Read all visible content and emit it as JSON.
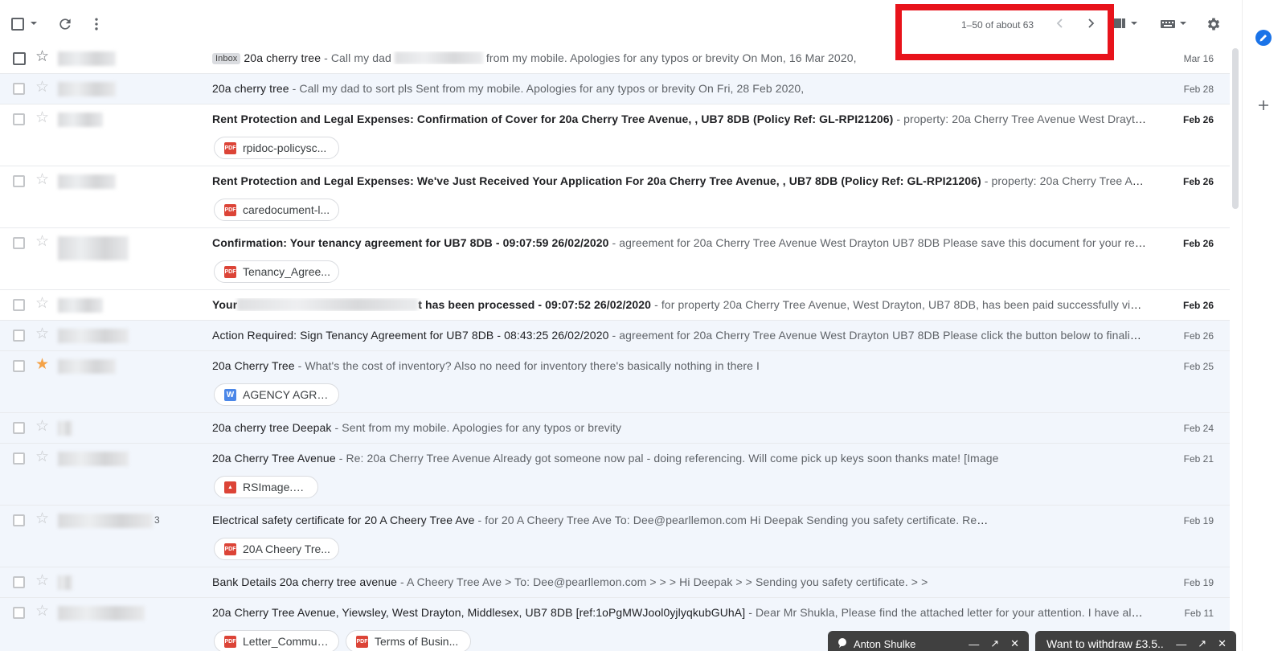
{
  "toolbar": {
    "pager_text": "1–50 of about 63"
  },
  "emails": [
    {
      "badge": "Inbox",
      "subject": "20a cherry tree",
      "snippet": " - Call my dad ",
      "snippet_after": " from my mobile. Apologies for any typos or brevity On Mon, 16 Mar 2020,",
      "date": "Mar 16",
      "unread": false,
      "starred": false,
      "attachments": []
    },
    {
      "subject": "20a cherry tree",
      "snippet": " - Call my dad to sort pls Sent from my mobile. Apologies for any typos or brevity On Fri, 28 Feb 2020,",
      "date": "Feb 28",
      "unread": false,
      "starred": false,
      "attachments": []
    },
    {
      "subject": "Rent Protection and Legal Expenses: Confirmation of Cover for 20a Cherry Tree Avenue, , UB7 8DB (Policy Ref: GL-RPI21206)",
      "snippet": " - property: 20a Cherry Tree Avenue West Drayton UB7 8DB ...",
      "date": "Feb 26",
      "unread": true,
      "starred": false,
      "attachments": [
        {
          "type": "pdf",
          "name": "rpidoc-policysc..."
        }
      ]
    },
    {
      "subject": "Rent Protection and Legal Expenses: We've Just Received Your Application For 20a Cherry Tree Avenue, , UB7 8DB (Policy Ref: GL-RPI21206)",
      "snippet": " - property: 20a Cherry Tree Avenue West Dr...",
      "date": "Feb 26",
      "unread": true,
      "starred": false,
      "attachments": [
        {
          "type": "pdf",
          "name": "caredocument-l..."
        }
      ]
    },
    {
      "subject": "Confirmation: Your tenancy agreement for UB7 8DB - 09:07:59 26/02/2020",
      "snippet": " - agreement for 20a Cherry Tree Avenue West Drayton UB7 8DB Please save this document for your records. Re...",
      "date": "Feb 26",
      "unread": true,
      "starred": false,
      "attachments": [
        {
          "type": "pdf",
          "name": "Tenancy_Agree..."
        }
      ]
    },
    {
      "subject_prefix": "Your",
      "subject": "t has been processed - 09:07:52 26/02/2020",
      "snippet": " - for property 20a Cherry Tree Avenue, West Drayton, UB7 8DB, has been paid successfully via the goo...",
      "date": "Feb 26",
      "unread": true,
      "starred": false,
      "attachments": []
    },
    {
      "subject": "Action Required: Sign Tenancy Agreement for UB7 8DB - 08:43:25 26/02/2020",
      "snippet": " - agreement for 20a Cherry Tree Avenue West Drayton UB7 8DB Please click the button below to finalise the a...",
      "date": "Feb 26",
      "unread": false,
      "starred": false,
      "attachments": []
    },
    {
      "subject": "20a Cherry Tree",
      "snippet": " - What's the cost of inventory? Also no need for inventory there's basically nothing in there I",
      "date": "Feb 25",
      "unread": false,
      "starred": true,
      "attachments": [
        {
          "type": "word",
          "name": "AGENCY AGRE..."
        }
      ]
    },
    {
      "subject": "20a cherry tree Deepak",
      "snippet": " - Sent from my mobile. Apologies for any typos or brevity",
      "date": "Feb 24",
      "unread": false,
      "starred": false,
      "attachments": []
    },
    {
      "subject": "20a Cherry Tree Avenue",
      "snippet": " - Re: 20a Cherry Tree Avenue Already got someone now pal - doing referencing. Will come pick up keys soon thanks mate! [Image",
      "date": "Feb 21",
      "unread": false,
      "starred": false,
      "attachments": [
        {
          "type": "img",
          "name": "RSImage.png"
        }
      ]
    },
    {
      "sender_count": "3",
      "subject": "Electrical safety certificate for 20 A Cheery Tree Ave",
      "snippet": " - for 20 A Cheery Tree Ave To: Dee@pearllemon.com Hi Deepak Sending you safety certificate. Re",
      "date": "Feb 19",
      "unread": false,
      "starred": false,
      "attachments": [
        {
          "type": "pdf",
          "name": "20A Cheery Tre..."
        }
      ]
    },
    {
      "subject": "Bank Details 20a cherry tree avenue",
      "snippet": " - A Cheery Tree Ave > To: Dee@pearllemon.com > > > Hi Deepak > > Sending you safety certificate. > >",
      "date": "Feb 19",
      "unread": false,
      "starred": false,
      "attachments": []
    },
    {
      "subject": "20a Cherry Tree Avenue, Yiewsley, West Drayton, Middlesex, UB7 8DB [ref:1oPgMWJool0yjlyqkubGUhA]",
      "snippet": " - Dear Mr Shukla, Please find the attached letter for your attention. I have also attac...",
      "date": "Feb 11",
      "unread": false,
      "starred": false,
      "attachments": [
        {
          "type": "pdf",
          "name": "Letter_Commun..."
        },
        {
          "type": "pdf",
          "name": "Terms of Busin..."
        }
      ]
    }
  ],
  "chats": [
    {
      "name": "Anton Shulke"
    },
    {
      "name": "Want to withdraw £3.5..."
    }
  ],
  "colors": {
    "highlight": "#e8131b",
    "star_on": "#f4a247",
    "chat_bar": "#404040"
  },
  "icons": [
    "select-all-checkbox",
    "chevron-down-icon",
    "refresh-icon",
    "more-vert-icon",
    "chevron-left-icon",
    "chevron-right-icon",
    "split-pane-icon",
    "keyboard-icon",
    "gear-icon",
    "tasks-icon",
    "plus-icon",
    "star-icon",
    "pdf-icon",
    "word-icon",
    "image-icon",
    "chat-bubble-icon",
    "minimize-icon",
    "pop-out-icon",
    "close-icon"
  ]
}
